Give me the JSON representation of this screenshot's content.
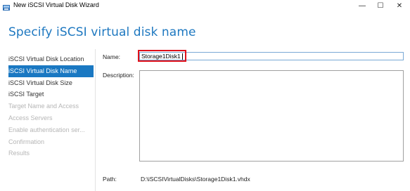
{
  "window": {
    "title": "New iSCSI Virtual Disk Wizard",
    "minimize_glyph": "—",
    "maximize_glyph": "☐",
    "close_glyph": "✕"
  },
  "header": {
    "title": "Specify iSCSI virtual disk name"
  },
  "nav": {
    "items": [
      {
        "label": "iSCSI Virtual Disk Location",
        "state": "enabled"
      },
      {
        "label": "iSCSI Virtual Disk Name",
        "state": "active"
      },
      {
        "label": "iSCSI Virtual Disk Size",
        "state": "enabled"
      },
      {
        "label": "iSCSI Target",
        "state": "enabled"
      },
      {
        "label": "Target Name and Access",
        "state": "disabled"
      },
      {
        "label": "Access Servers",
        "state": "disabled"
      },
      {
        "label": "Enable authentication ser...",
        "state": "disabled"
      },
      {
        "label": "Confirmation",
        "state": "disabled"
      },
      {
        "label": "Results",
        "state": "disabled"
      }
    ]
  },
  "form": {
    "name_label": "Name:",
    "name_value": "Storage1Disk1",
    "description_label": "Description:",
    "description_value": "",
    "path_label": "Path:",
    "path_value": "D:\\iSCSIVirtualDisks\\Storage1Disk1.vhdx"
  },
  "colors": {
    "accent": "#1a78c2",
    "highlight_box": "#e0101a",
    "header_text": "#1e78c0"
  }
}
